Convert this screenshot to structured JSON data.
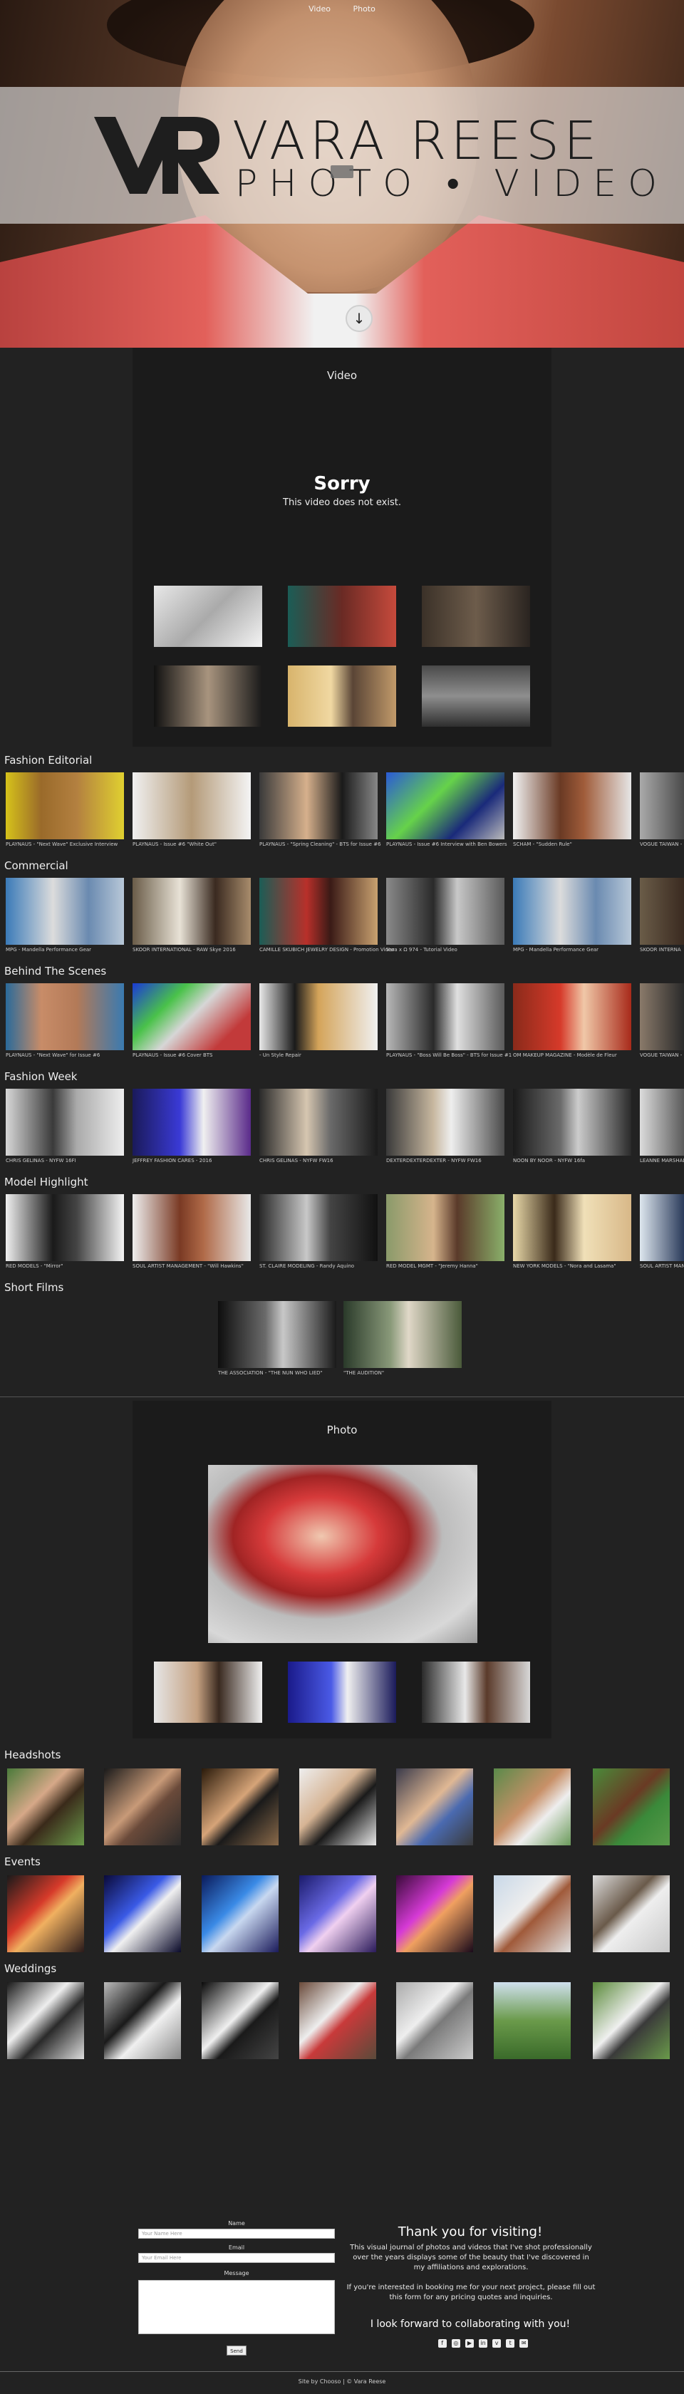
{
  "nav": {
    "items": [
      "Video",
      "Photo"
    ]
  },
  "brand": {
    "title": "VARA REESE",
    "subtitle": "PHOTO • VIDEO"
  },
  "video_section": {
    "title": "Video",
    "error_title": "Sorry",
    "error_message": "This video does not exist."
  },
  "fashion_editorial": {
    "label": "Fashion Editorial",
    "items": [
      "PLAYNAUS - \"Next Wave\" Exclusive Interview",
      "PLAYNAUS - Issue #6 \"White Out\"",
      "PLAYNAUS - \"Spring Cleaning\" - BTS for Issue #6",
      "PLAYNAUS - Issue #6 Interview with Ben Bowers",
      "SCHAM - \"Sudden Rule\"",
      "VOGUE TAIWAN - N"
    ]
  },
  "commercial": {
    "label": "Commercial",
    "items": [
      "MPG - Mandella Performance Gear",
      "SKOOR INTERNATIONAL - RAW Skye 2016",
      "CAMILLE SKUBICH JEWELRY DESIGN - Promotion Video",
      "Vara x Ω 974 - Tutorial Video",
      "MPG - Mandella Performance Gear",
      "SKOOR INTERNA"
    ]
  },
  "behind_the_scenes": {
    "label": "Behind The Scenes",
    "items": [
      "PLAYNAUS - \"Next Wave\" for Issue #6",
      "PLAYNAUS - Issue #6 Cover BTS",
      "- Un Style Repair",
      "PLAYNAUS - \"Boss Will Be Boss\" - BTS for Issue #1",
      "OM MAKEUP MAGAZINE - Modèle de Fleur",
      "VOGUE TAIWAN - N"
    ]
  },
  "fashion_week": {
    "label": "Fashion Week",
    "items": [
      "CHRIS GELINAS - NYFW 16FI",
      "JEFFREY FASHION CARES - 2016",
      "CHRIS GELINAS - NYFW FW16",
      "DEXTERDEXTERDEXTER - NYFW FW16",
      "NOON BY NOOR - NYFW 16fa",
      "LEANNE MARSHALL"
    ]
  },
  "model_highlight": {
    "label": "Model Highlight",
    "items": [
      "RED MODELS - \"Mirror\"",
      "SOUL ARTIST MANAGEMENT - \"Will Hawkins\"",
      "ST. CLAIRE MODELING - Randy Aquino",
      "RED MODEL MGMT - \"Jeremy Hanna\"",
      "NEW YORK MODELS - \"Nora and Lasama\"",
      "SOUL ARTIST MANA"
    ]
  },
  "short_films": {
    "label": "Short Films",
    "items": [
      "THE ASSOCIATION - \"THE NUN WHO LIED\"",
      "\"THE AUDITION\""
    ]
  },
  "photo_section": {
    "title": "Photo"
  },
  "headshots": {
    "label": "Headshots"
  },
  "events": {
    "label": "Events"
  },
  "weddings": {
    "label": "Weddings"
  },
  "form": {
    "name_label": "Name",
    "name_placeholder": "Your Name Here",
    "email_label": "Email",
    "email_placeholder": "Your Email Here",
    "message_label": "Message",
    "send_label": "Send"
  },
  "thanks": {
    "title": "Thank you for visiting!",
    "paragraph1": "This visual journal of photos and videos that I've shot professionally over the years displays some of the beauty that I've discovered in my affiliations and explorations.",
    "paragraph2": "If you're interested in booking me for your next project, please fill out this form for any pricing quotes and inquiries.",
    "collab": "I look forward to collaborating with you!"
  },
  "footer": {
    "text": "Site by Chooso | © Vara Reese"
  },
  "colors": {
    "background": "#222222",
    "panel": "#1b1b1b",
    "text": "#dddddd"
  }
}
